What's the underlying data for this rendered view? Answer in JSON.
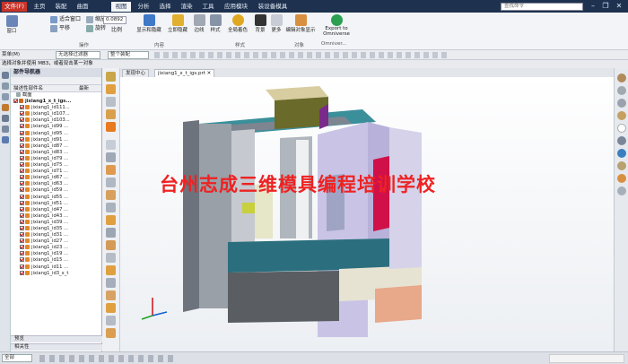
{
  "menubar": {
    "tabs": [
      {
        "label": "文件(F)"
      },
      {
        "label": "主页"
      },
      {
        "label": "装配"
      },
      {
        "label": "曲面"
      },
      {
        "label": "视图"
      },
      {
        "label": "分析"
      },
      {
        "label": "选择"
      },
      {
        "label": "渲染"
      },
      {
        "label": "工具"
      },
      {
        "label": "应用模块"
      },
      {
        "label": "装设备模具"
      }
    ],
    "search_placeholder": "查找命令"
  },
  "ribbon": {
    "window_label": "窗口",
    "fit_label": "适合窗口",
    "zoom_label": "缩放",
    "zoom_value": "0.0892",
    "pan_label": "平移",
    "rotate_label": "旋转",
    "scale_label": "比例",
    "operation_group": "操作",
    "show_hide_label": "显示和隐藏",
    "instant_hide_label": "立即隐藏",
    "content_group": "内容",
    "edge_label": "边线",
    "style_label": "样式",
    "global_label": "全局着色",
    "render_label": "背景",
    "more_label": "更多",
    "style_group": "样式",
    "edit_obj_label": "编辑对象显示",
    "object_group": "对象",
    "export_label": "Export to Omniverse",
    "omni_group": "Omniver..."
  },
  "selbar": {
    "menu_label": "菜单(M)",
    "filter_value": "无选择过滤器",
    "assembly_value": "整个装配"
  },
  "status_message": "选择对象并使用 MB3，或者双击某一对象",
  "nav": {
    "title": "部件导航器",
    "col_name": "描述性部件名",
    "col_latest": "最新",
    "section_label": "截面",
    "root": "jixiang1_x_t_igs...",
    "items": [
      "jixiang1_id111...",
      "jixiang1_id107...",
      "jixiang1_id103...",
      "jixiang1_id99 ...",
      "jixiang1_id95 ...",
      "jixiang1_id91 ...",
      "jixiang1_id87 ...",
      "jixiang1_id83 ...",
      "jixiang1_id79 ...",
      "jixiang1_id75 ...",
      "jixiang1_id71 ...",
      "jixiang1_id67 ...",
      "jixiang1_id63 ...",
      "jixiang1_id59 ...",
      "jixiang1_id55 ...",
      "jixiang1_id51 ...",
      "jixiang1_id47 ...",
      "jixiang1_id43 ...",
      "jixiang1_id39 ...",
      "jixiang1_id35 ...",
      "jixiang1_id31 ...",
      "jixiang1_id27 ...",
      "jixiang1_id23 ...",
      "jixiang1_id19 ...",
      "jixiang1_id15 ...",
      "jixiang1_id11 ...",
      "jixiang1_id3_x_t"
    ],
    "footer_preview": "预览",
    "footer_related": "相关性"
  },
  "tabs": {
    "discovery": "发现中心",
    "part": "jixiang1_x_t_igs.prt ✕"
  },
  "watermark": "台州志成三维模具编程培训学校",
  "statusbar": {
    "filter_value": "全部"
  },
  "colors": {
    "menubar": "#1e3250",
    "file_tab": "#c7342a",
    "watermark": "#ee2222",
    "machine_teal": "#3a8f9a",
    "machine_grey": "#8e969e",
    "machine_lilac": "#c9c4e6"
  }
}
